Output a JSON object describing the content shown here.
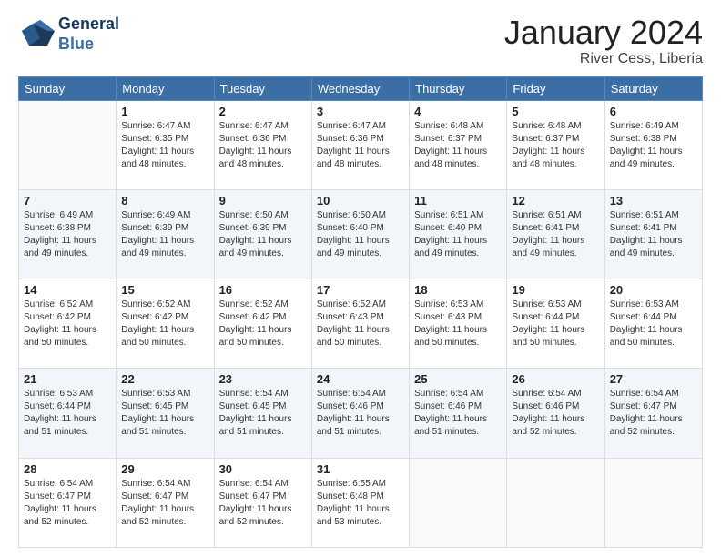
{
  "header": {
    "logo_line1": "General",
    "logo_line2": "Blue",
    "title": "January 2024",
    "subtitle": "River Cess, Liberia"
  },
  "columns": [
    "Sunday",
    "Monday",
    "Tuesday",
    "Wednesday",
    "Thursday",
    "Friday",
    "Saturday"
  ],
  "weeks": [
    [
      {
        "day": "",
        "sunrise": "",
        "sunset": "",
        "daylight": ""
      },
      {
        "day": "1",
        "sunrise": "Sunrise: 6:47 AM",
        "sunset": "Sunset: 6:35 PM",
        "daylight": "Daylight: 11 hours and 48 minutes."
      },
      {
        "day": "2",
        "sunrise": "Sunrise: 6:47 AM",
        "sunset": "Sunset: 6:36 PM",
        "daylight": "Daylight: 11 hours and 48 minutes."
      },
      {
        "day": "3",
        "sunrise": "Sunrise: 6:47 AM",
        "sunset": "Sunset: 6:36 PM",
        "daylight": "Daylight: 11 hours and 48 minutes."
      },
      {
        "day": "4",
        "sunrise": "Sunrise: 6:48 AM",
        "sunset": "Sunset: 6:37 PM",
        "daylight": "Daylight: 11 hours and 48 minutes."
      },
      {
        "day": "5",
        "sunrise": "Sunrise: 6:48 AM",
        "sunset": "Sunset: 6:37 PM",
        "daylight": "Daylight: 11 hours and 48 minutes."
      },
      {
        "day": "6",
        "sunrise": "Sunrise: 6:49 AM",
        "sunset": "Sunset: 6:38 PM",
        "daylight": "Daylight: 11 hours and 49 minutes."
      }
    ],
    [
      {
        "day": "7",
        "sunrise": "Sunrise: 6:49 AM",
        "sunset": "Sunset: 6:38 PM",
        "daylight": "Daylight: 11 hours and 49 minutes."
      },
      {
        "day": "8",
        "sunrise": "Sunrise: 6:49 AM",
        "sunset": "Sunset: 6:39 PM",
        "daylight": "Daylight: 11 hours and 49 minutes."
      },
      {
        "day": "9",
        "sunrise": "Sunrise: 6:50 AM",
        "sunset": "Sunset: 6:39 PM",
        "daylight": "Daylight: 11 hours and 49 minutes."
      },
      {
        "day": "10",
        "sunrise": "Sunrise: 6:50 AM",
        "sunset": "Sunset: 6:40 PM",
        "daylight": "Daylight: 11 hours and 49 minutes."
      },
      {
        "day": "11",
        "sunrise": "Sunrise: 6:51 AM",
        "sunset": "Sunset: 6:40 PM",
        "daylight": "Daylight: 11 hours and 49 minutes."
      },
      {
        "day": "12",
        "sunrise": "Sunrise: 6:51 AM",
        "sunset": "Sunset: 6:41 PM",
        "daylight": "Daylight: 11 hours and 49 minutes."
      },
      {
        "day": "13",
        "sunrise": "Sunrise: 6:51 AM",
        "sunset": "Sunset: 6:41 PM",
        "daylight": "Daylight: 11 hours and 49 minutes."
      }
    ],
    [
      {
        "day": "14",
        "sunrise": "Sunrise: 6:52 AM",
        "sunset": "Sunset: 6:42 PM",
        "daylight": "Daylight: 11 hours and 50 minutes."
      },
      {
        "day": "15",
        "sunrise": "Sunrise: 6:52 AM",
        "sunset": "Sunset: 6:42 PM",
        "daylight": "Daylight: 11 hours and 50 minutes."
      },
      {
        "day": "16",
        "sunrise": "Sunrise: 6:52 AM",
        "sunset": "Sunset: 6:42 PM",
        "daylight": "Daylight: 11 hours and 50 minutes."
      },
      {
        "day": "17",
        "sunrise": "Sunrise: 6:52 AM",
        "sunset": "Sunset: 6:43 PM",
        "daylight": "Daylight: 11 hours and 50 minutes."
      },
      {
        "day": "18",
        "sunrise": "Sunrise: 6:53 AM",
        "sunset": "Sunset: 6:43 PM",
        "daylight": "Daylight: 11 hours and 50 minutes."
      },
      {
        "day": "19",
        "sunrise": "Sunrise: 6:53 AM",
        "sunset": "Sunset: 6:44 PM",
        "daylight": "Daylight: 11 hours and 50 minutes."
      },
      {
        "day": "20",
        "sunrise": "Sunrise: 6:53 AM",
        "sunset": "Sunset: 6:44 PM",
        "daylight": "Daylight: 11 hours and 50 minutes."
      }
    ],
    [
      {
        "day": "21",
        "sunrise": "Sunrise: 6:53 AM",
        "sunset": "Sunset: 6:44 PM",
        "daylight": "Daylight: 11 hours and 51 minutes."
      },
      {
        "day": "22",
        "sunrise": "Sunrise: 6:53 AM",
        "sunset": "Sunset: 6:45 PM",
        "daylight": "Daylight: 11 hours and 51 minutes."
      },
      {
        "day": "23",
        "sunrise": "Sunrise: 6:54 AM",
        "sunset": "Sunset: 6:45 PM",
        "daylight": "Daylight: 11 hours and 51 minutes."
      },
      {
        "day": "24",
        "sunrise": "Sunrise: 6:54 AM",
        "sunset": "Sunset: 6:46 PM",
        "daylight": "Daylight: 11 hours and 51 minutes."
      },
      {
        "day": "25",
        "sunrise": "Sunrise: 6:54 AM",
        "sunset": "Sunset: 6:46 PM",
        "daylight": "Daylight: 11 hours and 51 minutes."
      },
      {
        "day": "26",
        "sunrise": "Sunrise: 6:54 AM",
        "sunset": "Sunset: 6:46 PM",
        "daylight": "Daylight: 11 hours and 52 minutes."
      },
      {
        "day": "27",
        "sunrise": "Sunrise: 6:54 AM",
        "sunset": "Sunset: 6:47 PM",
        "daylight": "Daylight: 11 hours and 52 minutes."
      }
    ],
    [
      {
        "day": "28",
        "sunrise": "Sunrise: 6:54 AM",
        "sunset": "Sunset: 6:47 PM",
        "daylight": "Daylight: 11 hours and 52 minutes."
      },
      {
        "day": "29",
        "sunrise": "Sunrise: 6:54 AM",
        "sunset": "Sunset: 6:47 PM",
        "daylight": "Daylight: 11 hours and 52 minutes."
      },
      {
        "day": "30",
        "sunrise": "Sunrise: 6:54 AM",
        "sunset": "Sunset: 6:47 PM",
        "daylight": "Daylight: 11 hours and 52 minutes."
      },
      {
        "day": "31",
        "sunrise": "Sunrise: 6:55 AM",
        "sunset": "Sunset: 6:48 PM",
        "daylight": "Daylight: 11 hours and 53 minutes."
      },
      {
        "day": "",
        "sunrise": "",
        "sunset": "",
        "daylight": ""
      },
      {
        "day": "",
        "sunrise": "",
        "sunset": "",
        "daylight": ""
      },
      {
        "day": "",
        "sunrise": "",
        "sunset": "",
        "daylight": ""
      }
    ]
  ]
}
